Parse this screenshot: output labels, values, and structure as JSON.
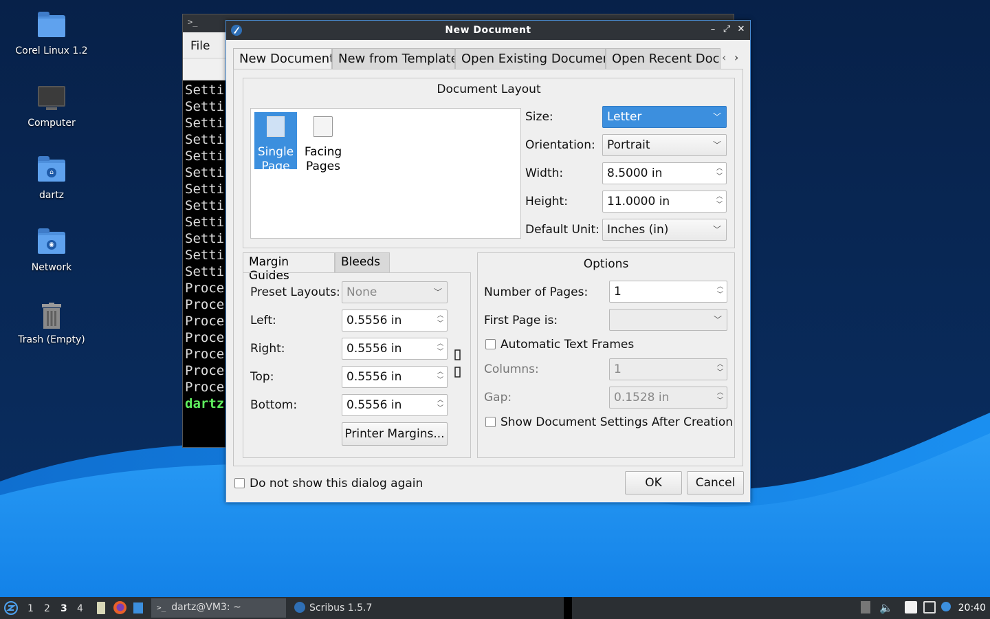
{
  "desktop": {
    "icons": [
      {
        "label": "Corel Linux 1.2",
        "icon": "folder-icon"
      },
      {
        "label": "Computer",
        "icon": "computer-icon"
      },
      {
        "label": "dartz",
        "icon": "home-folder-icon"
      },
      {
        "label": "Network",
        "icon": "network-folder-icon"
      },
      {
        "label": "Trash (Empty)",
        "icon": "trash-icon"
      }
    ]
  },
  "terminal": {
    "menu_file": "File",
    "lines": [
      "Setti",
      "Setti",
      "Setti",
      "Setti",
      "Setti",
      "Setti",
      "Setti",
      "Setti",
      "Setti",
      "Setti",
      "Setti",
      "Setti",
      "Proce",
      "Proce",
      "Proce",
      "Proce",
      "Proce",
      "Proce",
      "Proce"
    ],
    "prompt": "dartz"
  },
  "dialog": {
    "title": "New Document",
    "window_controls": {
      "minimize": "–",
      "maximize": "⤢",
      "close": "✕"
    },
    "tabs": [
      "New Document",
      "New from Template",
      "Open Existing Document",
      "Open Recent Docur"
    ],
    "layout": {
      "title": "Document Layout",
      "options": [
        {
          "label_line1": "Single",
          "label_line2": "Page"
        },
        {
          "label_line1": "Facing",
          "label_line2": "Pages"
        }
      ],
      "size_label": "Size:",
      "size_value": "Letter",
      "orientation_label": "Orientation:",
      "orientation_value": "Portrait",
      "width_label": "Width:",
      "width_value": "8.5000 in",
      "height_label": "Height:",
      "height_value": "11.0000 in",
      "unit_label": "Default Unit:",
      "unit_value": "Inches (in)"
    },
    "margins": {
      "tab_margin": "Margin Guides",
      "tab_bleeds": "Bleeds",
      "preset_label": "Preset Layouts:",
      "preset_value": "None",
      "left_label": "Left:",
      "left_value": "0.5556 in",
      "right_label": "Right:",
      "right_value": "0.5556 in",
      "top_label": "Top:",
      "top_value": "0.5556 in",
      "bottom_label": "Bottom:",
      "bottom_value": "0.5556 in",
      "printer_margins": "Printer Margins..."
    },
    "options": {
      "title": "Options",
      "pages_label": "Number of Pages:",
      "pages_value": "1",
      "first_page_label": "First Page is:",
      "first_page_value": "",
      "auto_text_frames": "Automatic Text Frames",
      "columns_label": "Columns:",
      "columns_value": "1",
      "gap_label": "Gap:",
      "gap_value": "0.1528 in",
      "show_settings": "Show Document Settings After Creation"
    },
    "dont_show": "Do not show this dialog again",
    "ok": "OK",
    "cancel": "Cancel"
  },
  "taskbar": {
    "workspaces": [
      "1",
      "2",
      "3",
      "4"
    ],
    "active_workspace": "3",
    "windows": [
      {
        "label": "dartz@VM3: ~",
        "icon": "terminal-icon"
      },
      {
        "label": "Scribus 1.5.7",
        "icon": "scribus-icon"
      }
    ],
    "clock": "20:40"
  },
  "colors": {
    "accent": "#3c8fde",
    "titlebar": "#2f3338",
    "wallpaper_dark": "#07214a",
    "wallpaper_wave": "#1a8ff0"
  }
}
